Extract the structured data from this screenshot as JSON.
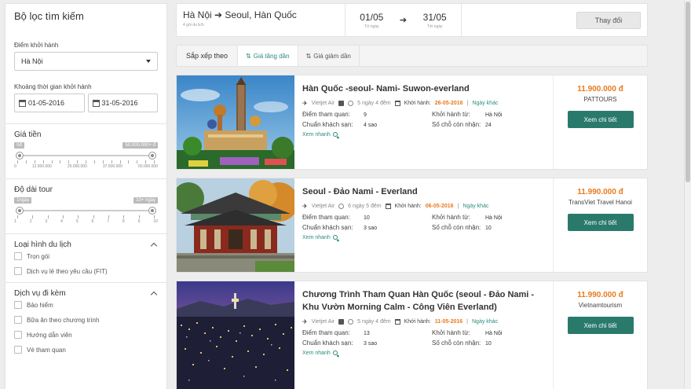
{
  "sidebar": {
    "title": "Bộ lọc tìm kiếm",
    "departure_label": "Điểm khởi hành",
    "departure_value": "Hà Nội",
    "period_label": "Khoảng thời gian khởi hành",
    "date_from": "01-05-2016",
    "date_to": "31-05-2016",
    "price": {
      "label": "Giá tiền",
      "min_tag": "0đ",
      "max_tag": "50.000.000+ đ",
      "tick_labels": [
        "0",
        "12.500.000",
        "25.000.000",
        "37.500.000",
        "50.000.000"
      ]
    },
    "duration": {
      "label": "Độ dài tour",
      "min_tag": "1ngày",
      "max_tag": "10+ ngày",
      "tick_labels": [
        "1",
        "2",
        "3",
        "4",
        "5",
        "6",
        "7",
        "8",
        "9",
        "10"
      ]
    },
    "tour_type": {
      "label": "Loại hình du lịch",
      "options": [
        "Trọn gói",
        "Dịch vụ lẻ theo yêu cầu (FIT)"
      ]
    },
    "services": {
      "label": "Dịch vụ đi kèm",
      "options": [
        "Bảo hiểm",
        "Bữa ăn theo chương trình",
        "Hướng dẫn viên",
        "Vé tham quan"
      ]
    }
  },
  "search": {
    "route": "Hà Nội ➔ Seoul, Hàn Quốc",
    "route_sub": "4 gói du lịch",
    "date_from": "01/05",
    "date_from_label": "Từ ngày",
    "date_to": "31/05",
    "date_to_label": "Tới ngày",
    "change_button": "Thay đổi"
  },
  "sort": {
    "label": "Sắp xếp theo",
    "asc": "Giá tăng dần",
    "desc": "Giá giảm dần"
  },
  "labels": {
    "departure": "Khởi hành:",
    "other_days": "Ngày khác",
    "attractions": "Điểm tham quan:",
    "hotel": "Chuẩn khách sạn:",
    "depart_from": "Khởi hành từ:",
    "seats": "Số chỗ còn nhận:",
    "quick_view": "Xem nhanh",
    "detail": "Xem chi tiết"
  },
  "tours": [
    {
      "title": "Hàn Quốc -seoul- Nami- Suwon-everland",
      "airline": "Vietjet Air",
      "duration": "5 ngày 4 đêm",
      "date": "26-05-2016",
      "attractions": "9",
      "hotel": "4 sao",
      "from": "Hà Nội",
      "seats": "24",
      "price": "11.900.000 đ",
      "agency": "PATTOURS"
    },
    {
      "title": "Seoul - Đảo Nami - Everland",
      "airline": "Vietjet Air",
      "duration": "6 ngày 5 đêm",
      "date": "06-05-2016",
      "attractions": "10",
      "hotel": "3 sao",
      "from": "Hà Nội",
      "seats": "10",
      "price": "11.990.000 đ",
      "agency": "TransViet Travel Hanoi"
    },
    {
      "title": "Chương Trình Tham Quan Hàn Quốc (seoul - Đảo Nami - Khu Vườn Morning Calm - Công Viên Everland)",
      "airline": "Vietjet Air",
      "duration": "5 ngày 4 đêm",
      "date": "11-05-2016",
      "attractions": "13",
      "hotel": "3 sao",
      "from": "Hà Nội",
      "seats": "10",
      "price": "11.990.000 đ",
      "agency": "Vietnamtourism"
    }
  ],
  "colors": {
    "accent": "#2a7a6c",
    "price": "#e87a1e"
  }
}
